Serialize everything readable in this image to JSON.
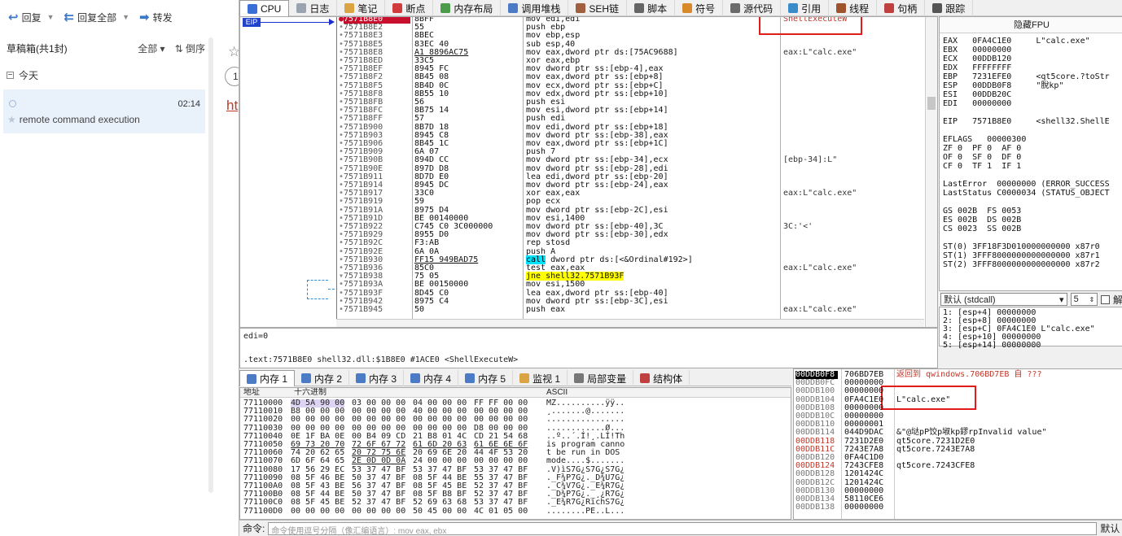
{
  "mail": {
    "toolbar": {
      "reply": "回复",
      "reply_all": "回复全部",
      "forward": "转发"
    },
    "folder": {
      "title": "草稿箱(共1封)",
      "filter": "全部",
      "sort": "倒序"
    },
    "group": "今天",
    "message": {
      "time": "02:14",
      "subject": "remote command execution"
    },
    "side": {
      "count": "1",
      "link": "ht"
    }
  },
  "tabs": [
    {
      "label": "CPU",
      "color": "#3a6fd8"
    },
    {
      "label": "日志",
      "color": "#9aa4b1"
    },
    {
      "label": "笔记",
      "color": "#d9a441"
    },
    {
      "label": "断点",
      "color": "#d23b3b"
    },
    {
      "label": "内存布局",
      "color": "#4b9b4b"
    },
    {
      "label": "调用堆栈",
      "color": "#4b7bc4"
    },
    {
      "label": "SEH链",
      "color": "#a06040"
    },
    {
      "label": "脚本",
      "color": "#666666"
    },
    {
      "label": "符号",
      "color": "#d88a2b"
    },
    {
      "label": "源代码",
      "color": "#6b6b6b"
    },
    {
      "label": "引用",
      "color": "#3a8cc8"
    },
    {
      "label": "线程",
      "color": "#a0522d"
    },
    {
      "label": "句柄",
      "color": "#c04040"
    },
    {
      "label": "跟踪",
      "color": "#555555"
    }
  ],
  "eip_label": "EIP",
  "disasm": [
    {
      "addr": "7571B8E0",
      "hex": "8BFF",
      "asm": "mov edi,edi",
      "cmt": "ShellExecuteW",
      "cur": true
    },
    {
      "addr": "7571B8E2",
      "hex": "55",
      "asm": "push ebp",
      "cmt": ""
    },
    {
      "addr": "7571B8E3",
      "hex": "8BEC",
      "asm": "mov ebp,esp",
      "cmt": ""
    },
    {
      "addr": "7571B8E5",
      "hex": "83EC 40",
      "asm": "sub esp,40",
      "cmt": ""
    },
    {
      "addr": "7571B8E8",
      "hex": "A1 8896AC75",
      "asm": "mov eax,dword ptr ds:[75AC9688]",
      "cmt": "eax:L\"calc.exe\""
    },
    {
      "addr": "7571B8ED",
      "hex": "33C5",
      "asm": "xor eax,ebp",
      "cmt": ""
    },
    {
      "addr": "7571B8EF",
      "hex": "8945 FC",
      "asm": "mov dword ptr ss:[ebp-4],eax",
      "cmt": ""
    },
    {
      "addr": "7571B8F2",
      "hex": "8B45 08",
      "asm": "mov eax,dword ptr ss:[ebp+8]",
      "cmt": ""
    },
    {
      "addr": "7571B8F5",
      "hex": "8B4D 0C",
      "asm": "mov ecx,dword ptr ss:[ebp+C]",
      "cmt": ""
    },
    {
      "addr": "7571B8F8",
      "hex": "8B55 10",
      "asm": "mov edx,dword ptr ss:[ebp+10]",
      "cmt": ""
    },
    {
      "addr": "7571B8FB",
      "hex": "56",
      "asm": "push esi",
      "cmt": ""
    },
    {
      "addr": "7571B8FC",
      "hex": "8B75 14",
      "asm": "mov esi,dword ptr ss:[ebp+14]",
      "cmt": ""
    },
    {
      "addr": "7571B8FF",
      "hex": "57",
      "asm": "push edi",
      "cmt": ""
    },
    {
      "addr": "7571B900",
      "hex": "8B7D 18",
      "asm": "mov edi,dword ptr ss:[ebp+18]",
      "cmt": ""
    },
    {
      "addr": "7571B903",
      "hex": "8945 C8",
      "asm": "mov dword ptr ss:[ebp-38],eax",
      "cmt": ""
    },
    {
      "addr": "7571B906",
      "hex": "8B45 1C",
      "asm": "mov eax,dword ptr ss:[ebp+1C]",
      "cmt": ""
    },
    {
      "addr": "7571B909",
      "hex": "6A 07",
      "asm": "push 7",
      "cmt": ""
    },
    {
      "addr": "7571B90B",
      "hex": "894D CC",
      "asm": "mov dword ptr ss:[ebp-34],ecx",
      "cmt": "[ebp-34]:L\""
    },
    {
      "addr": "7571B90E",
      "hex": "897D D8",
      "asm": "mov dword ptr ss:[ebp-28],edi",
      "cmt": ""
    },
    {
      "addr": "7571B911",
      "hex": "8D7D E0",
      "asm": "lea edi,dword ptr ss:[ebp-20]",
      "cmt": ""
    },
    {
      "addr": "7571B914",
      "hex": "8945 DC",
      "asm": "mov dword ptr ss:[ebp-24],eax",
      "cmt": ""
    },
    {
      "addr": "7571B917",
      "hex": "33C0",
      "asm": "xor eax,eax",
      "cmt": "eax:L\"calc.exe\""
    },
    {
      "addr": "7571B919",
      "hex": "59",
      "asm": "pop ecx",
      "cmt": ""
    },
    {
      "addr": "7571B91A",
      "hex": "8975 D4",
      "asm": "mov dword ptr ss:[ebp-2C],esi",
      "cmt": ""
    },
    {
      "addr": "7571B91D",
      "hex": "BE 00140000",
      "asm": "mov esi,1400",
      "cmt": ""
    },
    {
      "addr": "7571B922",
      "hex": "C745 C0 3C000000",
      "asm": "mov dword ptr ss:[ebp-40],3C",
      "cmt": "3C:'<'"
    },
    {
      "addr": "7571B929",
      "hex": "8955 D0",
      "asm": "mov dword ptr ss:[ebp-30],edx",
      "cmt": ""
    },
    {
      "addr": "7571B92C",
      "hex": "F3:AB",
      "asm": "rep stosd",
      "cmt": ""
    },
    {
      "addr": "7571B92E",
      "hex": "6A 0A",
      "asm": "push A",
      "cmt": ""
    },
    {
      "addr": "7571B930",
      "hex": "FF15 949BAD75",
      "asm": "call dword ptr ds:[<&Ordinal#192>]",
      "cmt": "",
      "call": true
    },
    {
      "addr": "7571B936",
      "hex": "85C0",
      "asm": "test eax,eax",
      "cmt": "eax:L\"calc.exe\""
    },
    {
      "addr": "7571B938",
      "hex": "75 05",
      "asm": "jne shell32.7571B93F",
      "cmt": "",
      "jmp": true
    },
    {
      "addr": "7571B93A",
      "hex": "BE 00150000",
      "asm": "mov esi,1500",
      "cmt": ""
    },
    {
      "addr": "7571B93F",
      "hex": "8D45 C0",
      "asm": "lea eax,dword ptr ss:[ebp-40]",
      "cmt": ""
    },
    {
      "addr": "7571B942",
      "hex": "8975 C4",
      "asm": "mov dword ptr ss:[ebp-3C],esi",
      "cmt": ""
    },
    {
      "addr": "7571B945",
      "hex": "50",
      "asm": "push eax",
      "cmt": "eax:L\"calc.exe\""
    }
  ],
  "regs": {
    "header": "隐藏FPU",
    "lines": [
      "EAX   0FA4C1E0     L\"calc.exe\"",
      "EBX   00000000",
      "ECX   00DDB120",
      "EDX   FFFFFFFF",
      "EBP   7231EFE0     <qt5core.?toStr",
      "ESP   00DDB0F8     \"脫kp\"",
      "ESI   00DDB20C",
      "EDI   00000000",
      "",
      "EIP   7571B8E0     <shell32.ShellE",
      "",
      "EFLAGS   00000300",
      "ZF 0  PF 0  AF 0",
      "OF 0  SF 0  DF 0",
      "CF 0  TF 1  IF 1",
      "",
      "LastError  00000000 (ERROR_SUCCESS",
      "LastStatus C0000034 (STATUS_OBJECT",
      "",
      "GS 002B  FS 0053",
      "ES 002B  DS 002B",
      "CS 0023  SS 002B",
      "",
      "ST(0) 3FF18F3D010000000000 x87r0",
      "ST(1) 3FFF8000000000000000 x87r1",
      "ST(2) 3FFF8000000000000000 x87r2"
    ]
  },
  "callconv": {
    "value": "默认 (stdcall)",
    "count": "5",
    "lock_label": "解"
  },
  "args": [
    "1: [esp+4] 00000000",
    "2: [esp+8] 00000000",
    "3: [esp+C] 0FA4C1E0 L\"calc.exe\"",
    "4: [esp+10] 00000000",
    "5: [esp+14] 00000000"
  ],
  "info": {
    "line1": "edi=0",
    "line2": ".text:7571B8E0 shell32.dll:$1B8E0 #1ACE0 <ShellExecuteW>"
  },
  "memtabs": [
    {
      "label": "内存 1",
      "color": "#4b7bc4"
    },
    {
      "label": "内存 2",
      "color": "#4b7bc4"
    },
    {
      "label": "内存 3",
      "color": "#4b7bc4"
    },
    {
      "label": "内存 4",
      "color": "#4b7bc4"
    },
    {
      "label": "内存 5",
      "color": "#4b7bc4"
    },
    {
      "label": "监视 1",
      "color": "#d9a441"
    },
    {
      "label": "局部变量",
      "color": "#777777"
    },
    {
      "label": "结构体",
      "color": "#c04040"
    }
  ],
  "dump": {
    "headers": {
      "addr": "地址",
      "hex": "十六进制",
      "ascii": "ASCII"
    },
    "rows": [
      {
        "addr": "77110000",
        "hex": [
          "4D 5A 90 00",
          "03 00 00 00",
          "04 00 00 00",
          "FF FF 00 00"
        ],
        "ascii": "MZ..........ÿÿ.."
      },
      {
        "addr": "77110010",
        "hex": [
          "B8 00 00 00",
          "00 00 00 00",
          "40 00 00 00",
          "00 00 00 00"
        ],
        "ascii": "¸.......@......."
      },
      {
        "addr": "77110020",
        "hex": [
          "00 00 00 00",
          "00 00 00 00",
          "00 00 00 00",
          "00 00 00 00"
        ],
        "ascii": "................"
      },
      {
        "addr": "77110030",
        "hex": [
          "00 00 00 00",
          "00 00 00 00",
          "00 00 00 00",
          "D8 00 00 00"
        ],
        "ascii": "............Ø..."
      },
      {
        "addr": "77110040",
        "hex": [
          "0E 1F BA 0E",
          "00 B4 09 CD",
          "21 B8 01 4C",
          "CD 21 54 68"
        ],
        "ascii": "..º..´.Í!¸.LÍ!Th"
      },
      {
        "addr": "77110050",
        "hex": [
          "69 73 20 70",
          "72 6F 67 72",
          "61 6D 20 63",
          "61 6E 6E 6F"
        ],
        "ascii": "is program canno"
      },
      {
        "addr": "77110060",
        "hex": [
          "74 20 62 65",
          "20 72 75 6E",
          "20 69 6E 20",
          "44 4F 53 20"
        ],
        "ascii": "t be run in DOS "
      },
      {
        "addr": "77110070",
        "hex": [
          "6D 6F 64 65",
          "2E 0D 0D 0A",
          "24 00 00 00",
          "00 00 00 00"
        ],
        "ascii": "mode....$......."
      },
      {
        "addr": "77110080",
        "hex": [
          "17 56 29 EC",
          "53 37 47 BF",
          "53 37 47 BF",
          "53 37 47 BF"
        ],
        "ascii": ".V)ìS7G¿S7G¿S7G¿"
      },
      {
        "addr": "77110090",
        "hex": [
          "08 5F 46 BE",
          "50 37 47 BF",
          "08 5F 44 BE",
          "55 37 47 BF"
        ],
        "ascii": "._F¾P7G¿._D¾U7G¿"
      },
      {
        "addr": "771100A0",
        "hex": [
          "08 5F 43 BE",
          "56 37 47 BF",
          "08 5F 45 BE",
          "52 37 47 BF"
        ],
        "ascii": "._C¾V7G¿._E¾R7G¿"
      },
      {
        "addr": "771100B0",
        "hex": [
          "08 5F 44 BE",
          "50 37 47 BF",
          "08 5F B8 BF",
          "52 37 47 BF"
        ],
        "ascii": "._D¾P7G¿._¸¿R7G¿"
      },
      {
        "addr": "771100C0",
        "hex": [
          "08 5F 45 BE",
          "52 37 47 BF",
          "52 69 63 68",
          "53 37 47 BF"
        ],
        "ascii": "._E¾R7G¿RichS7G¿"
      },
      {
        "addr": "771100D0",
        "hex": [
          "00 00 00 00",
          "00 00 00 00",
          "50 45 00 00",
          "4C 01 05 00"
        ],
        "ascii": "........PE..L..."
      }
    ]
  },
  "stack": [
    {
      "a": "00DDB0F8",
      "v": "706BD7EB",
      "c": "返回到 qwindows.706BD7EB 自 ???",
      "top": true,
      "red": true
    },
    {
      "a": "00DDB0FC",
      "v": "00000000",
      "c": ""
    },
    {
      "a": "00DDB100",
      "v": "00000000",
      "c": ""
    },
    {
      "a": "00DDB104",
      "v": "0FA4C1E0",
      "c": "L\"calc.exe\""
    },
    {
      "a": "00DDB108",
      "v": "00000000",
      "c": ""
    },
    {
      "a": "00DDB10C",
      "v": "00000000",
      "c": ""
    },
    {
      "a": "00DDB110",
      "v": "00000001",
      "c": ""
    },
    {
      "a": "00DDB114",
      "v": "044D9DAC",
      "c": "&\"@垯pP饺p埱kp鏐rpInvalid value\""
    },
    {
      "a": "00DDB118",
      "v": "7231D2E0",
      "c": "qt5core.7231D2E0",
      "red_addr": true
    },
    {
      "a": "00DDB11C",
      "v": "7243E7A8",
      "c": "qt5core.7243E7A8",
      "red_addr": true
    },
    {
      "a": "00DDB120",
      "v": "0FA4C1D0",
      "c": ""
    },
    {
      "a": "00DDB124",
      "v": "7243CFE8",
      "c": "qt5core.7243CFE8",
      "red_addr": true
    },
    {
      "a": "00DDB128",
      "v": "1201424C",
      "c": ""
    },
    {
      "a": "00DDB12C",
      "v": "1201424C",
      "c": ""
    },
    {
      "a": "00DDB130",
      "v": "00000000",
      "c": ""
    },
    {
      "a": "00DDB134",
      "v": "58110CE6",
      "c": ""
    },
    {
      "a": "00DDB138",
      "v": "00000000",
      "c": ""
    }
  ],
  "cmd": {
    "label": "命令:",
    "placeholder": "命令使用逗号分隔（像汇编语言）: mov eax, ebx",
    "default_label": "默认"
  }
}
